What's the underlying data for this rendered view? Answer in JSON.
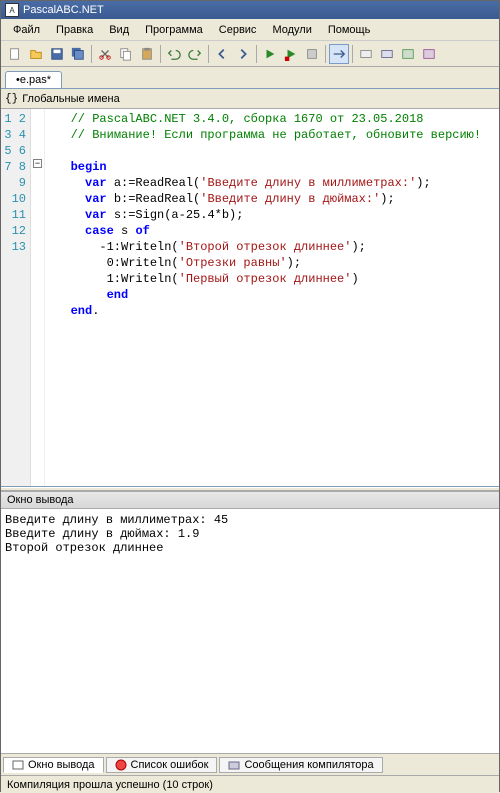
{
  "window": {
    "title": "PascalABC.NET"
  },
  "menu": [
    "Файл",
    "Правка",
    "Вид",
    "Программа",
    "Сервис",
    "Модули",
    "Помощь"
  ],
  "tab": {
    "label": "•e.pas*"
  },
  "scope": {
    "label": "Глобальные имена"
  },
  "code": {
    "lines": [
      {
        "n": 1,
        "html": "<span class='c-comment'>// PascalABC.NET 3.4.0, сборка 1670 от 23.05.2018</span>"
      },
      {
        "n": 2,
        "html": "<span class='c-comment'>// Внимание! Если программа не работает, обновите версию!</span>"
      },
      {
        "n": 3,
        "html": ""
      },
      {
        "n": 4,
        "html": "<span class='c-keyword'>begin</span>"
      },
      {
        "n": 5,
        "html": "  <span class='c-keyword'>var</span> a:=ReadReal(<span class='c-string'>'Введите длину в миллиметрах:'</span>);"
      },
      {
        "n": 6,
        "html": "  <span class='c-keyword'>var</span> b:=ReadReal(<span class='c-string'>'Введите длину в дюймах:'</span>);"
      },
      {
        "n": 7,
        "html": "  <span class='c-keyword'>var</span> s:=Sign(a-25.4*b);"
      },
      {
        "n": 8,
        "html": "  <span class='c-keyword'>case</span> s <span class='c-keyword'>of</span>"
      },
      {
        "n": 9,
        "html": "    -1:Writeln(<span class='c-string'>'Второй отрезок длиннее'</span>);"
      },
      {
        "n": 10,
        "html": "     0:Writeln(<span class='c-string'>'Отрезки равны'</span>);"
      },
      {
        "n": 11,
        "html": "     1:Writeln(<span class='c-string'>'Первый отрезок длиннее'</span>)"
      },
      {
        "n": 12,
        "html": "     <span class='c-keyword'>end</span>"
      },
      {
        "n": 13,
        "html": "<span class='c-keyword'>end</span>."
      }
    ]
  },
  "output_panel": {
    "title": "Окно вывода"
  },
  "output_text": "Введите длину в миллиметрах: 45\nВведите длину в дюймах: 1.9\nВторой отрезок длиннее",
  "bottom_tabs": {
    "t1": "Окно вывода",
    "t2": "Список ошибок",
    "t3": "Сообщения компилятора"
  },
  "status": {
    "text": "Компиляция прошла успешно (10 строк)"
  }
}
